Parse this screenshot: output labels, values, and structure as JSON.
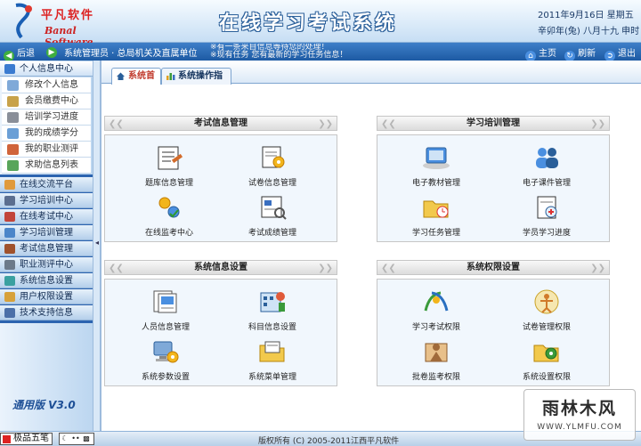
{
  "header": {
    "logo_cn": "平凡软件",
    "logo_en": "Banal Software",
    "title": "在线学习考试系统",
    "date_line1": "2011年9月16日 星期五",
    "date_line2": "辛卯年(兔) 八月十九 申时"
  },
  "navbar": {
    "back_label": "后退",
    "forward_label": "",
    "user_info": "系统管理员 · 总局机关及直属单位",
    "ticker_line1": "※有一条来自信息等待您的处理！",
    "ticker_line2": "※现有任务 您有最新的学习任务信息！",
    "home_label": "主页",
    "refresh_label": "刷新",
    "exit_label": "退出"
  },
  "sidebar": {
    "top_group": "个人信息中心",
    "sub_items": [
      "修改个人信息",
      "会员缴费中心",
      "培训学习进度",
      "我的成绩学分",
      "我的职业测评",
      "求助信息列表"
    ],
    "groups": [
      "在线交流平台",
      "学习培训中心",
      "在线考试中心",
      "学习培训管理",
      "考试信息管理",
      "职业测评中心",
      "系统信息设置",
      "用户权限设置",
      "技术支持信息"
    ],
    "version": "通用版 V3.0"
  },
  "tabs": [
    {
      "label": "系统首页"
    },
    {
      "label": "系统操作指南"
    }
  ],
  "panels": [
    {
      "title": "考试信息管理",
      "items": [
        "题库信息管理",
        "试卷信息管理",
        "在线监考中心",
        "考试成绩管理"
      ]
    },
    {
      "title": "学习培训管理",
      "items": [
        "电子教材管理",
        "电子课件管理",
        "学习任务管理",
        "学员学习进度"
      ]
    },
    {
      "title": "系统信息设置",
      "items": [
        "人员信息管理",
        "科目信息设置",
        "系统参数设置",
        "系统菜单管理"
      ]
    },
    {
      "title": "系统权限设置",
      "items": [
        "学习考试权限",
        "试卷管理权限",
        "批卷监考权限",
        "系统设置权限"
      ]
    }
  ],
  "footer": {
    "copyright": "版权所有 (C) 2005-2011江西平凡软件",
    "ime_label": "极品五笔"
  },
  "watermark": {
    "line1": "雨林木风",
    "line2": "WWW.YLMFU.COM"
  },
  "colors": {
    "nav_blue": "#1d5aa3",
    "accent_red": "#c0392b",
    "sidebar_bg": "#cfe3f6"
  }
}
